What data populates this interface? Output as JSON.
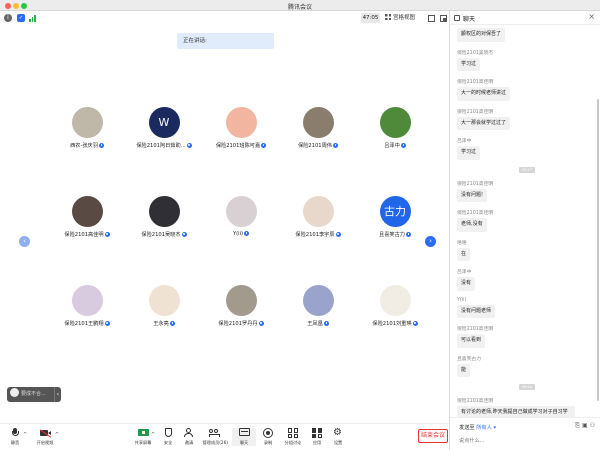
{
  "window": {
    "title": "腾讯会议"
  },
  "topbar": {
    "timer": "47:05",
    "view_label": "宫格视图"
  },
  "speaking": {
    "label": "正在讲话:"
  },
  "participants": [
    {
      "name": "西农-张庆羽",
      "avatar_color": "#bfb7a8",
      "avatar_text": ""
    },
    {
      "name": "保险2101阿日茹助...",
      "avatar_color": "#1b2a5e",
      "avatar_text": "W"
    },
    {
      "name": "保险2101班陈可嘉",
      "avatar_color": "#f2b5a0",
      "avatar_text": ""
    },
    {
      "name": "保险2101周伟",
      "avatar_color": "#8a7d6e",
      "avatar_text": ""
    },
    {
      "name": "吕泽中",
      "avatar_color": "#4e8a3a",
      "avatar_text": ""
    },
    {
      "name": "保险2101高佳明",
      "avatar_color": "#5a4a44",
      "avatar_text": ""
    },
    {
      "name": "保险2101吴晓杰",
      "avatar_color": "#2f2f35",
      "avatar_text": ""
    },
    {
      "name": "Y(ii)",
      "avatar_color": "#d8d0d3",
      "avatar_text": ""
    },
    {
      "name": "保险2101李宇辰",
      "avatar_color": "#e8d8cc",
      "avatar_text": ""
    },
    {
      "name": "且喜笑古力",
      "avatar_color": "#1f66e8",
      "avatar_text": "古力"
    },
    {
      "name": "保险2101王鹏翔",
      "avatar_color": "#d8cbe0",
      "avatar_text": ""
    },
    {
      "name": "王永亮",
      "avatar_color": "#efe2d2",
      "avatar_text": ""
    },
    {
      "name": "保险2101罗丹丹",
      "avatar_color": "#a29a8d",
      "avatar_text": ""
    },
    {
      "name": "王凤凰",
      "avatar_color": "#9aa3cc",
      "avatar_text": ""
    },
    {
      "name": "保险2101刘重瑛",
      "avatar_color": "#f1ede4",
      "avatar_text": ""
    }
  ],
  "mini_bar": {
    "label": "要成不合..."
  },
  "toolbar": {
    "items": [
      {
        "label": "静音",
        "icon": "mic-icon"
      },
      {
        "label": "开启视频",
        "icon": "camera-off-icon"
      },
      {
        "label": "共享屏幕",
        "icon": "share-screen-icon"
      },
      {
        "label": "安全",
        "icon": "shield-icon"
      },
      {
        "label": "邀请",
        "icon": "invite-icon"
      },
      {
        "label": "管理成员(26)",
        "icon": "members-icon"
      },
      {
        "label": "聊天",
        "icon": "chat-icon"
      },
      {
        "label": "录制",
        "icon": "record-icon"
      },
      {
        "label": "分组讨论",
        "icon": "breakout-icon"
      },
      {
        "label": "应用",
        "icon": "apps-icon"
      },
      {
        "label": "设置",
        "icon": "gear-icon"
      }
    ],
    "end_label": "结束会议"
  },
  "chat": {
    "title": "聊天",
    "messages": [
      {
        "sender": "",
        "text": "颤权区的对保吾了"
      },
      {
        "sender": "保险2101吴晓杰",
        "text": "学习过"
      },
      {
        "sender": "保险2101高佳明",
        "text": "大一的时候老师讲过"
      },
      {
        "sender": "保险2101高佳明",
        "text": "大一那会就学过过了"
      },
      {
        "sender": "吕泽中",
        "text": "学习过"
      },
      {
        "timestamp": "09:27"
      },
      {
        "sender": "保险2101高佳明",
        "text": "没有问题!"
      },
      {
        "sender": "保险2101高佳明",
        "text": "老师,没有"
      },
      {
        "sender": "嘻嘻",
        "text": "在"
      },
      {
        "sender": "吕泽中",
        "text": "没有"
      },
      {
        "sender": "Y(ii)",
        "text": "没有问题老师"
      },
      {
        "sender": "保险2101高佳明",
        "text": "可以看到"
      },
      {
        "sender": "且喜笑古力",
        "text": "能"
      },
      {
        "timestamp": "09:28"
      },
      {
        "sender": "保险2101高佳明",
        "text": "有讨论的老师,昨天我提自己做成学习对子自习学习"
      }
    ],
    "send_to_label": "发送至",
    "send_to_target": "所有人",
    "input_placeholder": "说点什么..."
  }
}
